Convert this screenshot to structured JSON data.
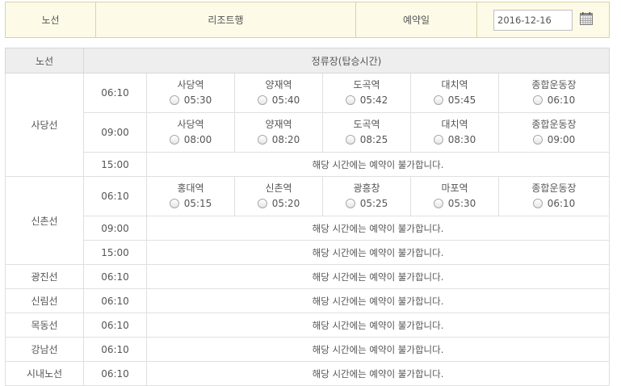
{
  "header": {
    "route_label": "노선",
    "route_value": "리조트행",
    "date_label": "예약일",
    "date_value": "2016-12-16",
    "calendar_icon": "calendar-icon"
  },
  "table": {
    "col_route": "노선",
    "col_stops": "정류장(탑승시간)",
    "unavailable_text": "해당 시간에는 예약이 불가합니다.",
    "lines": {
      "sadang": {
        "name": "사당선",
        "r1": {
          "time": "06:10",
          "stops": [
            {
              "name": "사당역",
              "time": "05:30"
            },
            {
              "name": "양재역",
              "time": "05:40"
            },
            {
              "name": "도곡역",
              "time": "05:42"
            },
            {
              "name": "대치역",
              "time": "05:45"
            },
            {
              "name": "종합운동장",
              "time": "06:10"
            }
          ]
        },
        "r2": {
          "time": "09:00",
          "stops": [
            {
              "name": "사당역",
              "time": "08:00"
            },
            {
              "name": "양재역",
              "time": "08:20"
            },
            {
              "name": "도곡역",
              "time": "08:25"
            },
            {
              "name": "대치역",
              "time": "08:30"
            },
            {
              "name": "종합운동장",
              "time": "09:00"
            }
          ]
        },
        "r3": {
          "time": "15:00"
        }
      },
      "sinchon": {
        "name": "신촌선",
        "r1": {
          "time": "06:10",
          "stops": [
            {
              "name": "홍대역",
              "time": "05:15"
            },
            {
              "name": "신촌역",
              "time": "05:20"
            },
            {
              "name": "광흥창",
              "time": "05:25"
            },
            {
              "name": "마포역",
              "time": "05:30"
            },
            {
              "name": "종합운동장",
              "time": "06:10"
            }
          ]
        },
        "r2": {
          "time": "09:00"
        },
        "r3": {
          "time": "15:00"
        }
      },
      "gwangjin": {
        "name": "광진선",
        "time": "06:10"
      },
      "sillim": {
        "name": "신림선",
        "time": "06:10"
      },
      "mokdong": {
        "name": "목동선",
        "time": "06:10"
      },
      "gangnam": {
        "name": "강남선",
        "time": "06:10"
      },
      "downtown": {
        "name": "시내노선",
        "time": "06:10"
      }
    }
  }
}
